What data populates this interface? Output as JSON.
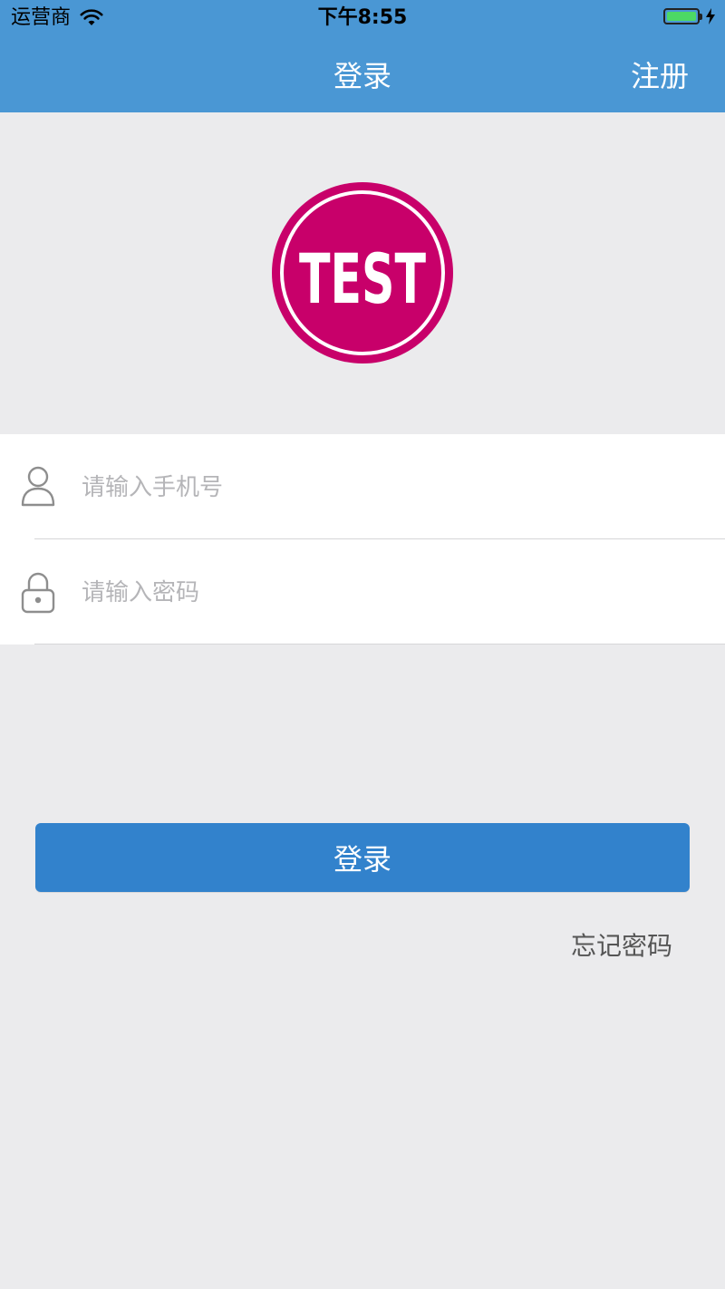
{
  "status_bar": {
    "carrier": "运营商",
    "time": "下午8:55"
  },
  "nav": {
    "title": "登录",
    "register": "注册"
  },
  "logo": {
    "text": "TEST",
    "color": "#c8006a"
  },
  "form": {
    "phone_placeholder": "请输入手机号",
    "password_placeholder": "请输入密码"
  },
  "actions": {
    "login": "登录",
    "forgot_password": "忘记密码"
  },
  "colors": {
    "nav_blue": "#4a97d4",
    "button_blue": "#3282cc",
    "background": "#ebebed"
  }
}
